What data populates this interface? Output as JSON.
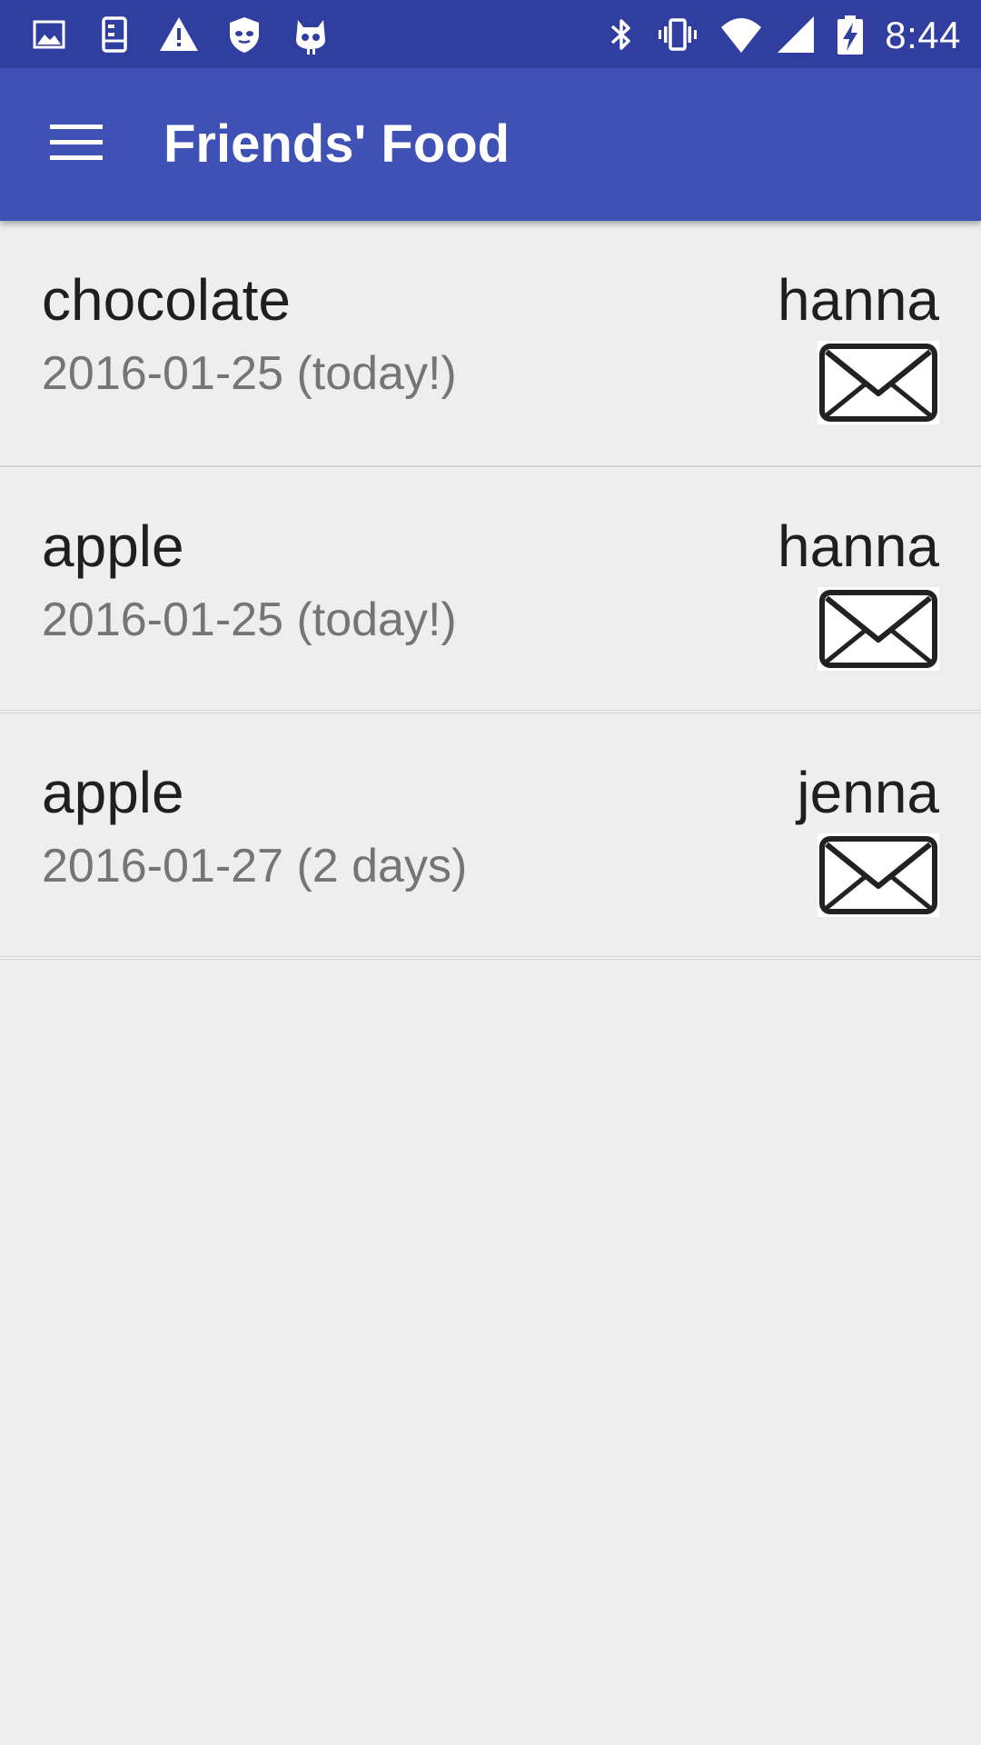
{
  "status_bar": {
    "time": "8:44",
    "left_icons": [
      "image-icon",
      "device-icon",
      "warning-icon",
      "shield-icon",
      "cyanogen-icon"
    ],
    "right_icons": [
      "bluetooth-icon",
      "vibrate-icon",
      "wifi-icon",
      "cell-signal-icon",
      "battery-charging-icon"
    ]
  },
  "app_bar": {
    "title": "Friends' Food",
    "menu_icon": "hamburger-menu-icon"
  },
  "items": [
    {
      "food": "chocolate",
      "date": "2016-01-25 (today!)",
      "friend": "hanna",
      "action_icon": "mail-icon"
    },
    {
      "food": "apple",
      "date": "2016-01-25 (today!)",
      "friend": "hanna",
      "action_icon": "mail-icon"
    },
    {
      "food": "apple",
      "date": "2016-01-27 (2 days)",
      "friend": "jenna",
      "action_icon": "mail-icon"
    }
  ],
  "colors": {
    "status_bar": "#303f9f",
    "app_bar": "#3f51b5",
    "background": "#eeeeee",
    "primary_text": "#1f1f1f",
    "secondary_text": "#757575"
  }
}
